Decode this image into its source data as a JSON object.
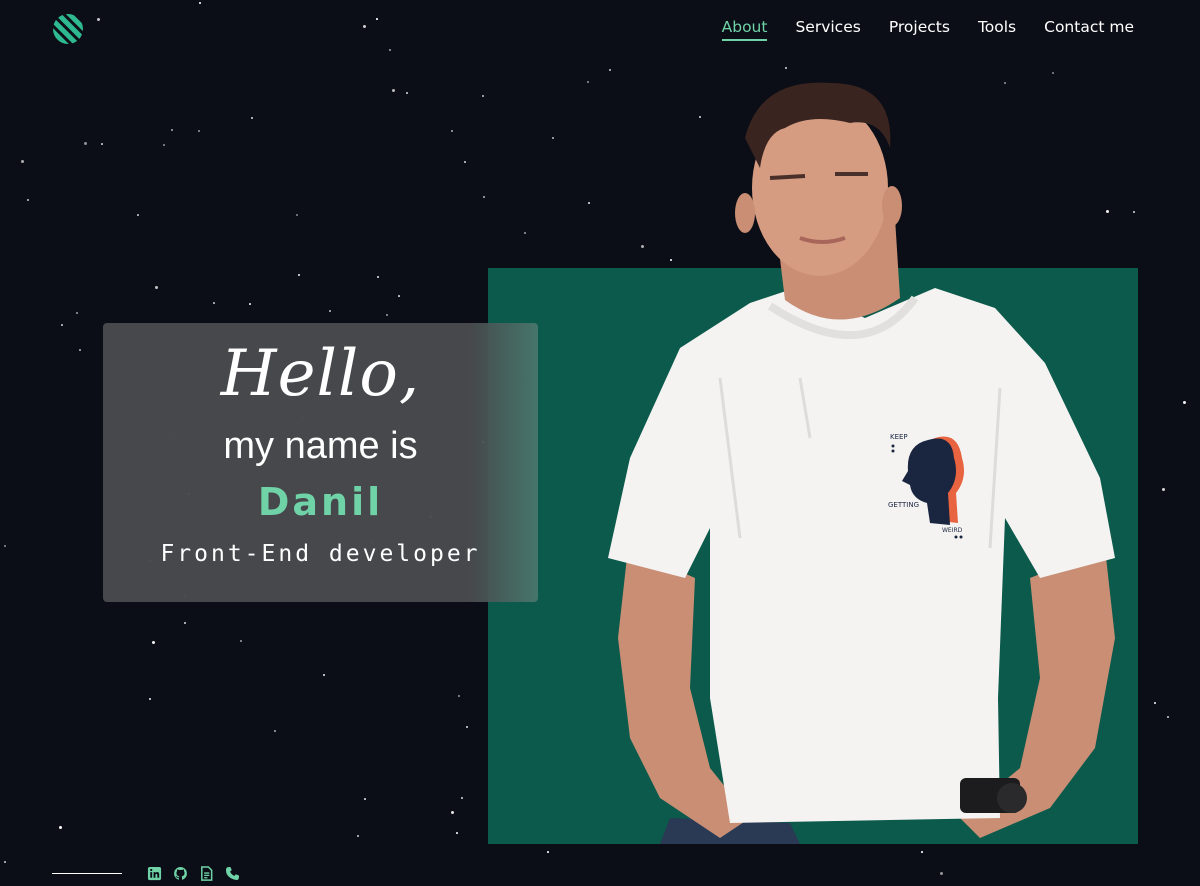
{
  "nav": {
    "items": [
      {
        "label": "About",
        "active": true
      },
      {
        "label": "Services",
        "active": false
      },
      {
        "label": "Projects",
        "active": false
      },
      {
        "label": "Tools",
        "active": false
      },
      {
        "label": "Contact me",
        "active": false
      }
    ]
  },
  "hero": {
    "greeting": "Hello,",
    "intro": "my name is",
    "name": "Danil",
    "role": "Front-End developer"
  },
  "photo": {
    "shirt_print_top": "KEEP",
    "shirt_print_mid": "GETTING",
    "shirt_print_bottom": "WEIRD"
  },
  "socials": [
    "linkedin-icon",
    "github-icon",
    "resume-icon",
    "phone-icon"
  ],
  "colors": {
    "background": "#0b0e16",
    "accent": "#6fd3a7",
    "photo_panel": "#0b5a4c",
    "card": "#484a4e"
  }
}
